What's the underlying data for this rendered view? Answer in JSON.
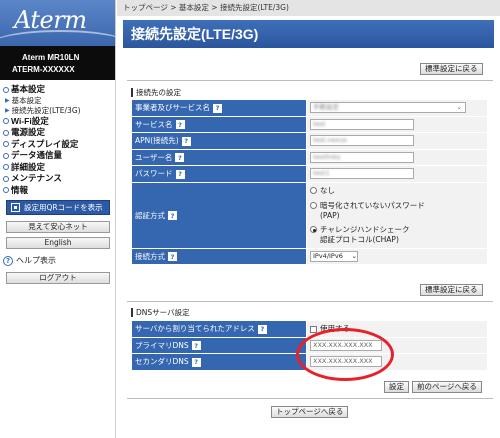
{
  "sidebar": {
    "logo": "Aterm",
    "model_line1": "Aterm   MR10LN",
    "model_line2": "ATERM-XXXXXX",
    "nav": [
      {
        "label": "基本設定",
        "subs": [
          "基本設定",
          "接続先設定(LTE/3G)"
        ]
      },
      {
        "label": "Wi-Fi設定"
      },
      {
        "label": "電源設定"
      },
      {
        "label": "ディスプレイ設定"
      },
      {
        "label": "データ通信量"
      },
      {
        "label": "詳細設定"
      },
      {
        "label": "メンテナンス"
      },
      {
        "label": "情報"
      }
    ],
    "qr_button": "設定用QRコードを表示",
    "safe_net_button": "見えて安心ネット",
    "english_button": "English",
    "help_label": "ヘルプ表示",
    "logout_button": "ログアウト"
  },
  "main": {
    "breadcrumb": "トップページ > 基本設定 > 接続先設定(LTE/3G)",
    "title": "接続先設定(LTE/3G)",
    "default_button": "標準設定に戻る",
    "connection_section": "接続先の設定",
    "fields": {
      "carrier_label": "事業者及びサービス名",
      "carrier_value": "手動設定",
      "service_label": "サービス名",
      "service_value": "test",
      "apn_label": "APN(接続先)",
      "apn_value": "test.nexus",
      "user_label": "ユーザー名",
      "user_value": "testlinks",
      "password_label": "パスワード",
      "password_value": "test1",
      "auth_label": "認証方式",
      "auth_options": [
        "なし",
        "暗号化されていないパスワード",
        "(PAP)",
        "チャレンジハンドシェーク",
        "認証プロトコル(CHAP)"
      ],
      "auth_selected": "CHAP",
      "conn_type_label": "接続方式",
      "conn_type_value": "IPv4/IPv6"
    },
    "dns_section": "DNSサーバ設定",
    "dns": {
      "auto_label": "サーバから割り当てられたアドレス",
      "auto_checkbox": "使用する",
      "auto_checked": false,
      "primary_label": "プライマリDNS",
      "primary_value": "XXX.XXX.XXX.XXX",
      "secondary_label": "セカンダリDNS",
      "secondary_value": "XXX.XXX.XXX.XXX"
    },
    "set_button": "設定",
    "prev_button": "前のページへ戻る",
    "top_button": "トップページへ戻る",
    "help_glyph": "?"
  },
  "colors": {
    "accent": "#3566b0",
    "highlight": "#e8202a"
  }
}
